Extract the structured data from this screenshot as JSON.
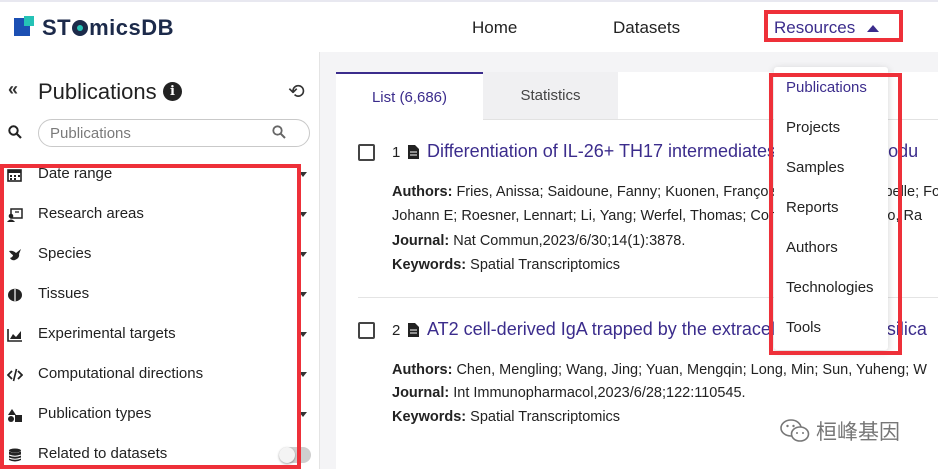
{
  "brand": {
    "logo_text_prefix": "ST",
    "logo_text_suffix": "micsDB",
    "colors": {
      "primary": "#3b2c8c",
      "brand_blue": "#1b4fb3",
      "brand_teal": "#25c2b6",
      "annotation_red": "#ee3039"
    }
  },
  "nav": {
    "home": "Home",
    "datasets": "Datasets",
    "resources": "Resources"
  },
  "sidebar": {
    "collapse_icon": "double-chevron-left-icon",
    "title": "Publications",
    "info_glyph": "i",
    "reset_icon": "reset-icon",
    "search_placeholder": "Publications",
    "filters": [
      {
        "label": "Date range",
        "icon": "calendar-icon"
      },
      {
        "label": "Research areas",
        "icon": "research-icon"
      },
      {
        "label": "Species",
        "icon": "species-icon"
      },
      {
        "label": "Tissues",
        "icon": "tissue-icon"
      },
      {
        "label": "Experimental targets",
        "icon": "chart-icon"
      },
      {
        "label": "Computational directions",
        "icon": "code-icon"
      },
      {
        "label": "Publication types",
        "icon": "shapes-icon"
      },
      {
        "label": "Related to datasets",
        "icon": "database-icon",
        "toggle": false
      }
    ]
  },
  "tabs": {
    "list": "List (6,686)",
    "statistics": "Statistics"
  },
  "publications": [
    {
      "number": "1",
      "title": "Differentiation of IL-26+ TH17 intermediates into IL-17A produ",
      "authors_label": "Authors:",
      "authors_line1": "Fries, Anissa; Saidoune, Fanny; Kuonen, François; Dupanloup, Isabelle; Fo",
      "authors_line2": "Johann E; Roesner, Lennart; Li, Yang; Werfel, Thomas; Conrad, Curdin; Prado, Ra",
      "journal_label": "Journal:",
      "journal": "Nat Commun,2023/6/30;14(1):3878.",
      "keywords_label": "Keywords:",
      "keywords": "Spatial Transcriptomics"
    },
    {
      "number": "2",
      "title": "AT2 cell-derived IgA trapped by the extracellular matrix in silica",
      "authors_label": "Authors:",
      "authors_line1": "Chen, Mengling; Wang, Jing; Yuan, Mengqin; Long, Min; Sun, Yuheng; W",
      "journal_label": "Journal:",
      "journal": "Int Immunopharmacol,2023/6/28;122:110545.",
      "keywords_label": "Keywords:",
      "keywords": "Spatial Transcriptomics"
    }
  ],
  "resources_menu": [
    "Publications",
    "Projects",
    "Samples",
    "Reports",
    "Authors",
    "Technologies",
    "Tools"
  ],
  "watermark": {
    "text": "桓峰基因",
    "icon": "wechat-icon"
  }
}
